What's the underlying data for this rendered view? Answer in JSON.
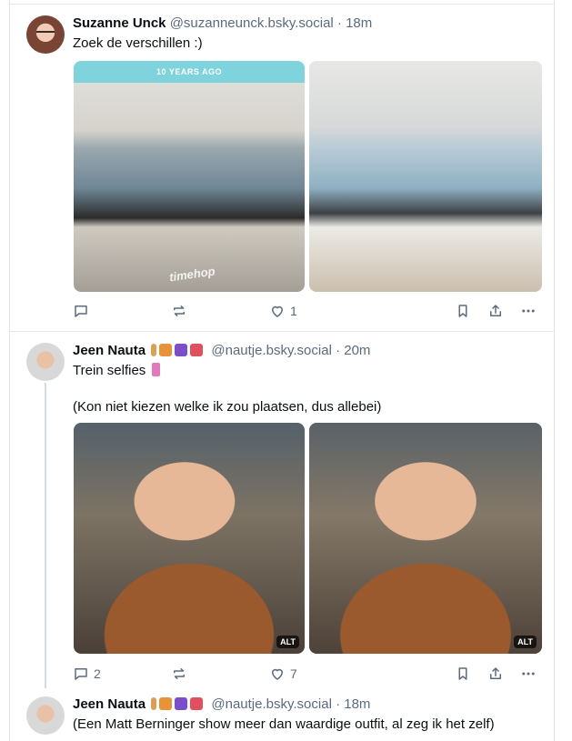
{
  "posts": [
    {
      "author": "Suzanne Unck",
      "handle": "@suzanneunck.bsky.social",
      "time": "· 18m",
      "text": "Zoek de verschillen :)",
      "images": [
        {
          "banner": "10 YEARS AGO",
          "watermark": "timehop"
        },
        {}
      ],
      "actions": {
        "reply_count": "",
        "repost_count": "",
        "like_count": "1"
      }
    },
    {
      "author": "Jeen Nauta",
      "handle": "@nautje.bsky.social",
      "time": "· 20m",
      "text_line1": "Trein selfies",
      "text_line2": "(Kon niet kiezen welke ik zou plaatsen, dus allebei)",
      "images": [
        {
          "alt_badge": "ALT"
        },
        {
          "alt_badge": "ALT"
        }
      ],
      "actions": {
        "reply_count": "2",
        "repost_count": "",
        "like_count": "7"
      }
    },
    {
      "author": "Jeen Nauta",
      "handle": "@nautje.bsky.social",
      "time": "· 18m",
      "text": "(Een Matt Berninger show meer dan waardige outfit, al zeg ik het zelf)"
    }
  ],
  "icons": [
    "reply-icon",
    "repost-icon",
    "like-icon",
    "bookmark-icon",
    "share-icon",
    "more-icon"
  ],
  "colors": {
    "muted": "#5b6b7c",
    "border": "#e4e8ec",
    "thread": "#d3dae1",
    "banner": "#7fd3dc"
  }
}
